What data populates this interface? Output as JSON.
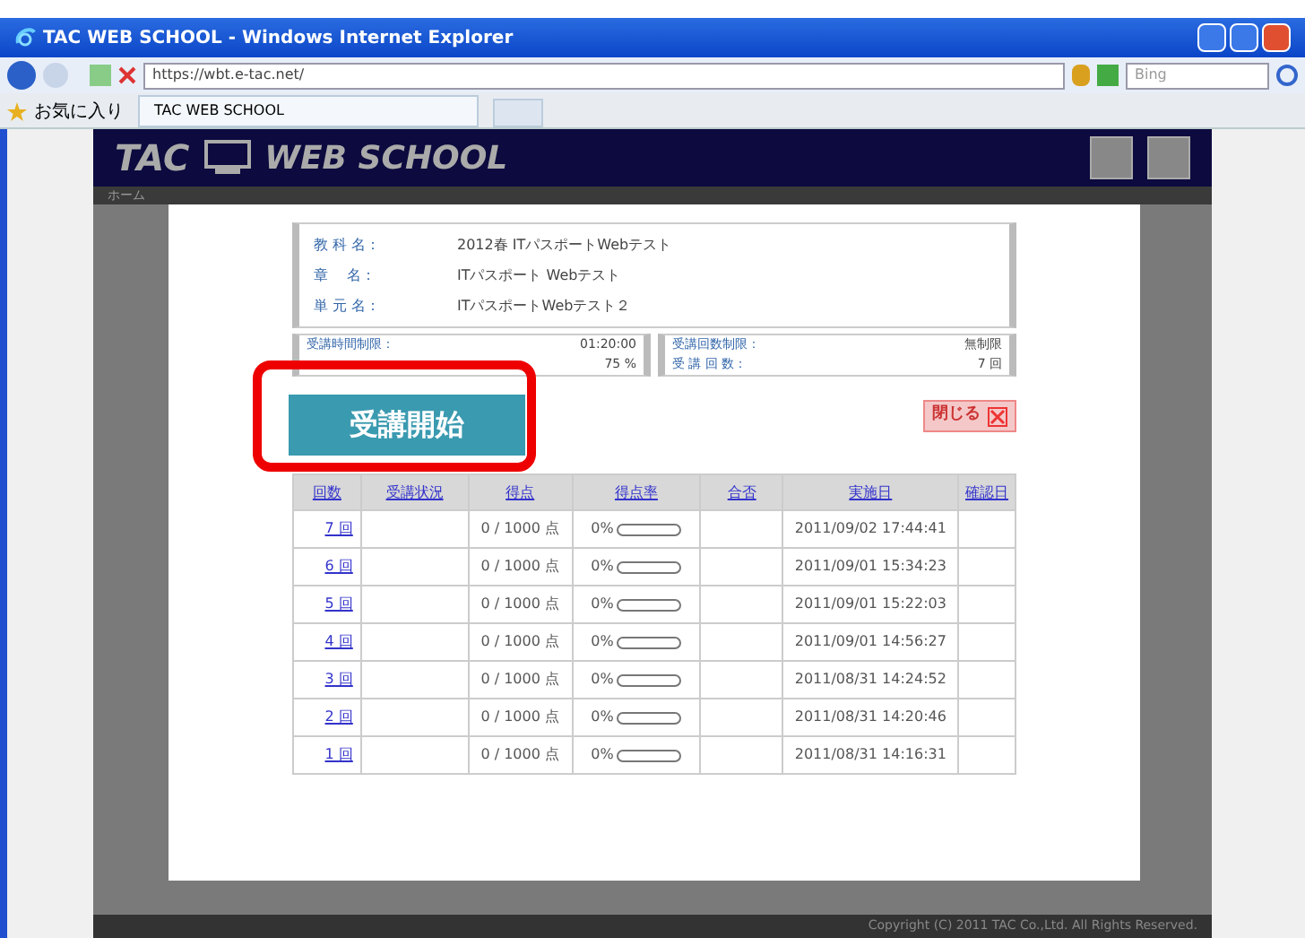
{
  "window": {
    "title": "TAC WEB SCHOOL - Windows Internet Explorer"
  },
  "address_bar": {
    "url": "https://wbt.e-tac.net/",
    "search_placeholder": "Bing"
  },
  "favorites_bar": {
    "favorites": "お気に入り",
    "tab": "TAC WEB SCHOOL"
  },
  "site": {
    "logo": "TAC",
    "logo_2": "WEB SCHOOL",
    "nav": "ホーム",
    "footer": "Copyright (C) 2011 TAC Co.,Ltd. All Rights Reserved."
  },
  "dialog": {
    "info": [
      {
        "label": "教 科 名：",
        "value": "2012春 ITパスポートWebテスト"
      },
      {
        "label": "章　 名：",
        "value": "ITパスポート Webテスト"
      },
      {
        "label": "単 元 名：",
        "value": "ITパスポートWebテスト２"
      }
    ],
    "limits_left": [
      {
        "label": "受講時間制限：",
        "value": "01:20:00"
      },
      {
        "value": "75 %"
      }
    ],
    "limits_right": [
      {
        "label": "受講回数制限：",
        "value": "無制限"
      },
      {
        "label": "受 講 回 数：",
        "value": "7 回"
      }
    ],
    "start_button": "受講開始",
    "close_button": "閉じる",
    "table": {
      "columns": [
        "回数",
        "受講状況",
        "得点",
        "得点率",
        "合否",
        "実施日",
        "確認日"
      ],
      "rows": [
        {
          "attempt": "7 回",
          "score": "0 / 1000 点",
          "rate": "0%",
          "level": 0,
          "date": "2011/09/02 17:44:41"
        },
        {
          "attempt": "6 回",
          "score": "0 / 1000 点",
          "rate": "0%",
          "level": 0,
          "date": "2011/09/01 15:34:23"
        },
        {
          "attempt": "5 回",
          "score": "0 / 1000 点",
          "rate": "0%",
          "level": 0,
          "date": "2011/09/01 15:22:03"
        },
        {
          "attempt": "4 回",
          "score": "0 / 1000 点",
          "rate": "0%",
          "level": 0,
          "date": "2011/09/01 14:56:27"
        },
        {
          "attempt": "3 回",
          "score": "0 / 1000 点",
          "rate": "0%",
          "level": 0,
          "date": "2011/08/31 14:24:52"
        },
        {
          "attempt": "2 回",
          "score": "0 / 1000 点",
          "rate": "0%",
          "level": 0,
          "date": "2011/08/31 14:20:46"
        },
        {
          "attempt": "1 回",
          "score": "0 / 1000 点",
          "rate": "0%",
          "level": 0,
          "date": "2011/08/31 14:16:31"
        }
      ]
    }
  }
}
